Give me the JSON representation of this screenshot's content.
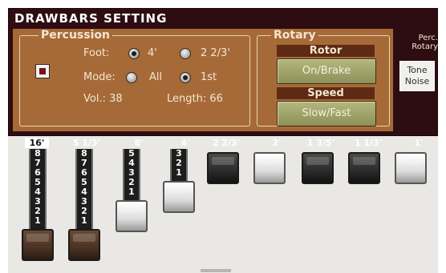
{
  "title": "DRAWBARS SETTING",
  "percussion": {
    "label": "Percussion",
    "on": true,
    "foot_label": "Foot:",
    "foot_options": [
      "4'",
      "2 2/3'"
    ],
    "foot_selected": "4'",
    "mode_label": "Mode:",
    "mode_options": [
      "All",
      "1st"
    ],
    "mode_selected": "1st",
    "volume_text": "Vol.: 38",
    "length_text": "Length: 66"
  },
  "rotary": {
    "label": "Rotary",
    "rotor_label": "Rotor",
    "rotor_button": "On/Brake",
    "speed_label": "Speed",
    "speed_button": "Slow/Fast"
  },
  "perc_rotary_label": "Perc.\nRotary",
  "tone_noise_label": "Tone\nNoise",
  "drawbars": [
    {
      "foot": "16'",
      "level": 8,
      "color": "brown",
      "selected": true
    },
    {
      "foot": "5 1/3'",
      "level": 8,
      "color": "brown",
      "selected": false
    },
    {
      "foot": "8'",
      "level": 5,
      "color": "white",
      "selected": false
    },
    {
      "foot": "4'",
      "level": 3,
      "color": "white",
      "selected": false
    },
    {
      "foot": "2 2/3'",
      "level": 0,
      "color": "black",
      "selected": false
    },
    {
      "foot": "2'",
      "level": 0,
      "color": "white",
      "selected": false
    },
    {
      "foot": "1 3/5'",
      "level": 0,
      "color": "black",
      "selected": false
    },
    {
      "foot": "1 1/3'",
      "level": 0,
      "color": "black",
      "selected": false
    },
    {
      "foot": "1'",
      "level": 0,
      "color": "white",
      "selected": false
    }
  ],
  "colors": {
    "panel_bg": "#2e0d12",
    "section_bg": "#a66a38",
    "button_bg": "#a4a86e",
    "check_mark": "#7a1020"
  }
}
